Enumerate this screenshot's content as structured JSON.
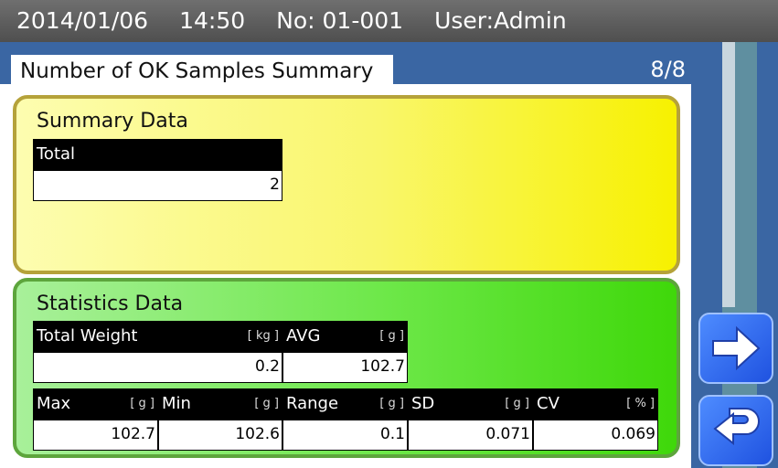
{
  "header": {
    "date": "2014/01/06",
    "time": "14:50",
    "number": "No: 01-001",
    "user": "User:Admin"
  },
  "page": {
    "title": "Number of OK Samples Summary",
    "indicator": "8/8"
  },
  "summary": {
    "title": "Summary Data",
    "total_label": "Total",
    "total_value": "2"
  },
  "statistics": {
    "title": "Statistics Data",
    "total_weight": {
      "label": "Total Weight",
      "unit": "[ kg ]",
      "value": "0.2"
    },
    "avg": {
      "label": "AVG",
      "unit": "[ g ]",
      "value": "102.7"
    },
    "max": {
      "label": "Max",
      "unit": "[ g ]",
      "value": "102.7"
    },
    "min": {
      "label": "Min",
      "unit": "[ g ]",
      "value": "102.6"
    },
    "range": {
      "label": "Range",
      "unit": "[ g ]",
      "value": "0.1"
    },
    "sd": {
      "label": "SD",
      "unit": "[ g ]",
      "value": "0.071"
    },
    "cv": {
      "label": "CV",
      "unit": "[ % ]",
      "value": "0.069"
    }
  },
  "nav": {
    "next_icon": "arrow-right-icon",
    "back_icon": "return-icon"
  },
  "colors": {
    "top_bar": "#5f5f5f",
    "blue": "#3a66a3",
    "summary_bg": "#f9f66a",
    "summary_border": "#b5a23a",
    "stats_bg": "#6ee84a",
    "stats_border": "#5da53c",
    "button": "#2f66f0"
  }
}
